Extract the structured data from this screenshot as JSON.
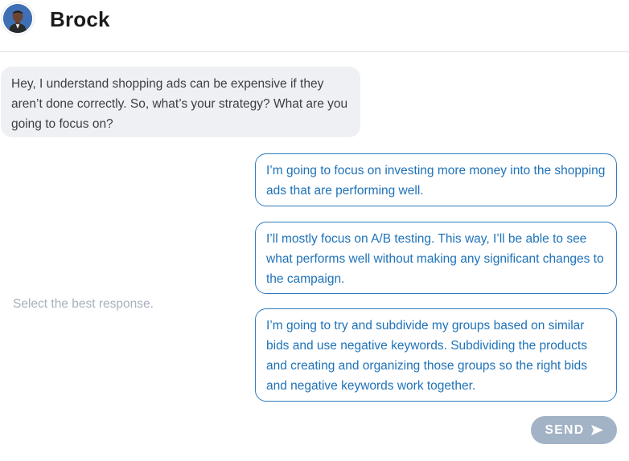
{
  "header": {
    "contact_name": "Brock",
    "avatar_icon": "person-avatar"
  },
  "conversation": {
    "bot_message": "Hey, I understand shopping ads can be expensive if they aren’t done correctly. So, what’s your strategy? What are you going to focus on?"
  },
  "prompt": "Select the best response.",
  "options": [
    {
      "label": "I’m going to focus on investing more money into the shopping ads that are performing well."
    },
    {
      "label": "I’ll mostly focus on A/B testing. This way, I’ll be able to see what performs well without making any significant changes to the campaign."
    },
    {
      "label": "I’m going to try and subdivide my groups based on similar bids and use negative keywords. Subdividing the products and creating and organizing those groups so the right bids and negative keywords work together."
    }
  ],
  "send_button": {
    "label": "SEND",
    "icon": "send-arrow-icon",
    "enabled": false
  },
  "colors": {
    "accent": "#1f72b8",
    "bubble_bg": "#eef0f3",
    "send_disabled": "#a3b3c6",
    "prompt_text": "#a7b0bb"
  }
}
